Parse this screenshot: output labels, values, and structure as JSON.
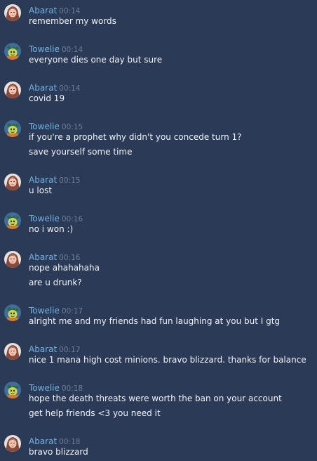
{
  "colors": {
    "background": "#2b3a56",
    "name_abarat": "#6eb3e3",
    "name_towelie": "#6eb3e3",
    "timestamp": "#6d7f99",
    "text": "#f0f3f8"
  },
  "users": {
    "abarat": {
      "name": "Abarat",
      "avatar_icon": "abarat-avatar-icon"
    },
    "towelie": {
      "name": "Towelie",
      "avatar_icon": "towelie-avatar-icon"
    }
  },
  "messages": [
    {
      "user": "abarat",
      "time": "00:14",
      "lines": [
        "remember my words"
      ]
    },
    {
      "user": "towelie",
      "time": "00:14",
      "lines": [
        "everyone dies one day but sure"
      ]
    },
    {
      "user": "abarat",
      "time": "00:14",
      "lines": [
        "covid 19"
      ]
    },
    {
      "user": "towelie",
      "time": "00:15",
      "lines": [
        "if you're a prophet why didn't you concede turn 1?",
        "save yourself some time"
      ]
    },
    {
      "user": "abarat",
      "time": "00:15",
      "lines": [
        "u lost"
      ]
    },
    {
      "user": "towelie",
      "time": "00:16",
      "lines": [
        "no i won :)"
      ]
    },
    {
      "user": "abarat",
      "time": "00:16",
      "lines": [
        "nope ahahahaha",
        "are u drunk?"
      ]
    },
    {
      "user": "towelie",
      "time": "00:17",
      "lines": [
        "alright me and my friends had fun laughing at you but I gtg"
      ]
    },
    {
      "user": "abarat",
      "time": "00:17",
      "lines": [
        "nice 1 mana high cost minions. bravo blizzard. thanks for balance"
      ]
    },
    {
      "user": "towelie",
      "time": "00:18",
      "lines": [
        "hope the death threats were worth the ban on your account",
        "get help friends <3 you need it"
      ]
    },
    {
      "user": "abarat",
      "time": "00:18",
      "lines": [
        "bravo blizzard"
      ]
    }
  ]
}
